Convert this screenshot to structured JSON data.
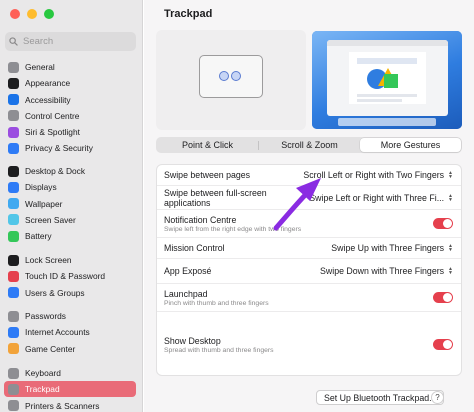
{
  "window": {
    "title": "Trackpad"
  },
  "search": {
    "placeholder": "Search"
  },
  "colors": {
    "accent": "#e96b78",
    "toggle_on": "#e5404d",
    "arrow": "#8a2be2"
  },
  "sidebar": {
    "groups": [
      [
        {
          "label": "General",
          "icon": "gear-icon",
          "color": "#8e8e93"
        },
        {
          "label": "Appearance",
          "icon": "appearance-icon",
          "color": "#1d1d1f"
        },
        {
          "label": "Accessibility",
          "icon": "accessibility-icon",
          "color": "#1a73e8"
        },
        {
          "label": "Control Centre",
          "icon": "control-centre-icon",
          "color": "#8e8e93"
        },
        {
          "label": "Siri & Spotlight",
          "icon": "siri-icon",
          "color": "#9b4de0"
        },
        {
          "label": "Privacy & Security",
          "icon": "hand-icon",
          "color": "#2e7bf6"
        }
      ],
      [
        {
          "label": "Desktop & Dock",
          "icon": "dock-icon",
          "color": "#1d1d1f"
        },
        {
          "label": "Displays",
          "icon": "display-icon",
          "color": "#2e7bf6"
        },
        {
          "label": "Wallpaper",
          "icon": "wallpaper-icon",
          "color": "#40a9f0"
        },
        {
          "label": "Screen Saver",
          "icon": "screen-saver-icon",
          "color": "#52c6e8"
        },
        {
          "label": "Battery",
          "icon": "battery-icon",
          "color": "#34c759"
        }
      ],
      [
        {
          "label": "Lock Screen",
          "icon": "lock-icon",
          "color": "#1d1d1f"
        },
        {
          "label": "Touch ID & Password",
          "icon": "fingerprint-icon",
          "color": "#e5404d"
        },
        {
          "label": "Users & Groups",
          "icon": "users-icon",
          "color": "#2e7bf6"
        }
      ],
      [
        {
          "label": "Passwords",
          "icon": "key-icon",
          "color": "#8e8e93"
        },
        {
          "label": "Internet Accounts",
          "icon": "at-icon",
          "color": "#2e7bf6"
        },
        {
          "label": "Game Center",
          "icon": "game-center-icon",
          "color": "#f2a33a"
        }
      ],
      [
        {
          "label": "Keyboard",
          "icon": "keyboard-icon",
          "color": "#8e8e93"
        },
        {
          "label": "Trackpad",
          "icon": "trackpad-icon",
          "color": "#8e8e93",
          "active": true
        },
        {
          "label": "Printers & Scanners",
          "icon": "printer-icon",
          "color": "#8e8e93"
        }
      ]
    ]
  },
  "tabs": [
    "Point & Click",
    "Scroll & Zoom",
    "More Gestures"
  ],
  "selected_tab": "More Gestures",
  "settings": [
    {
      "label": "Swipe between pages",
      "value": "Scroll Left or Right with Two Fingers",
      "control": "select"
    },
    {
      "label": "Swipe between full-screen applications",
      "value": "Swipe Left or Right with Three Fi...",
      "control": "select"
    },
    {
      "label": "Notification Centre",
      "sub": "Swipe left from the right edge with two fingers",
      "control": "toggle",
      "on": true
    },
    {
      "label": "Mission Control",
      "value": "Swipe Up with Three Fingers",
      "control": "select"
    },
    {
      "label": "App Exposé",
      "value": "Swipe Down with Three Fingers",
      "control": "select"
    },
    {
      "label": "Launchpad",
      "sub": "Pinch with thumb and three fingers",
      "control": "toggle",
      "on": true
    },
    {
      "label": "Show Desktop",
      "sub": "Spread with thumb and three fingers",
      "control": "toggle",
      "on": true
    }
  ],
  "footer": {
    "bluetooth_button": "Set Up Bluetooth Trackpad...",
    "help": "?"
  }
}
